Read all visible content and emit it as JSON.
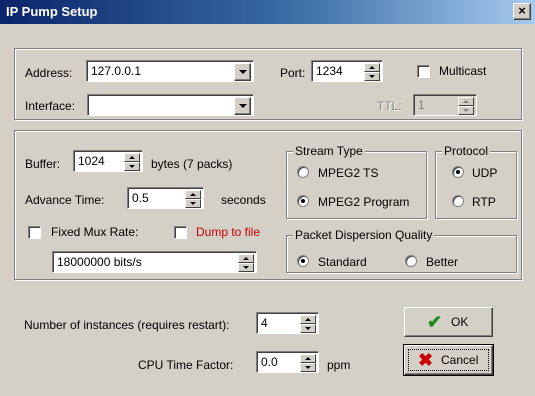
{
  "window": {
    "title": "IP Pump Setup",
    "close_icon": "×"
  },
  "network": {
    "address_label": "Address:",
    "address_value": "127.0.0.1",
    "port_label": "Port:",
    "port_value": "1234",
    "multicast_label": "Multicast",
    "multicast_checked": false,
    "interface_label": "Interface:",
    "interface_value": "",
    "ttl_label": "TTL:",
    "ttl_value": "1"
  },
  "settings": {
    "buffer_label": "Buffer:",
    "buffer_value": "1024",
    "buffer_unit": "bytes (7 packs)",
    "advance_label": "Advance Time:",
    "advance_value": "0.5",
    "advance_unit": "seconds",
    "fixed_mux_label": "Fixed Mux Rate:",
    "fixed_mux_checked": false,
    "dump_label": "Dump to file",
    "dump_checked": false,
    "mux_rate_value": "18000000 bits/s",
    "stream_type": {
      "legend": "Stream Type",
      "options": [
        "MPEG2 TS",
        "MPEG2 Program"
      ],
      "selected": "MPEG2 Program"
    },
    "protocol": {
      "legend": "Protocol",
      "options": [
        "UDP",
        "RTP"
      ],
      "selected": "UDP"
    },
    "dispersion": {
      "legend": "Packet Dispersion Quality",
      "options": [
        "Standard",
        "Better"
      ],
      "selected": "Standard"
    }
  },
  "bottom": {
    "instances_label": "Number of instances (requires restart):",
    "instances_value": "4",
    "cpu_label": "CPU Time Factor:",
    "cpu_value": "0.0",
    "cpu_unit": "ppm",
    "ok_label": "OK",
    "cancel_label": "Cancel",
    "ok_icon": "checkmark-icon",
    "cancel_icon": "x-icon"
  },
  "colors": {
    "title_bar": "#0a246a",
    "dialog_bg": "#d4d0c8",
    "dump_text": "#cc0000",
    "ok_check": "#1a8a1a",
    "cancel_x": "#cc0000"
  }
}
